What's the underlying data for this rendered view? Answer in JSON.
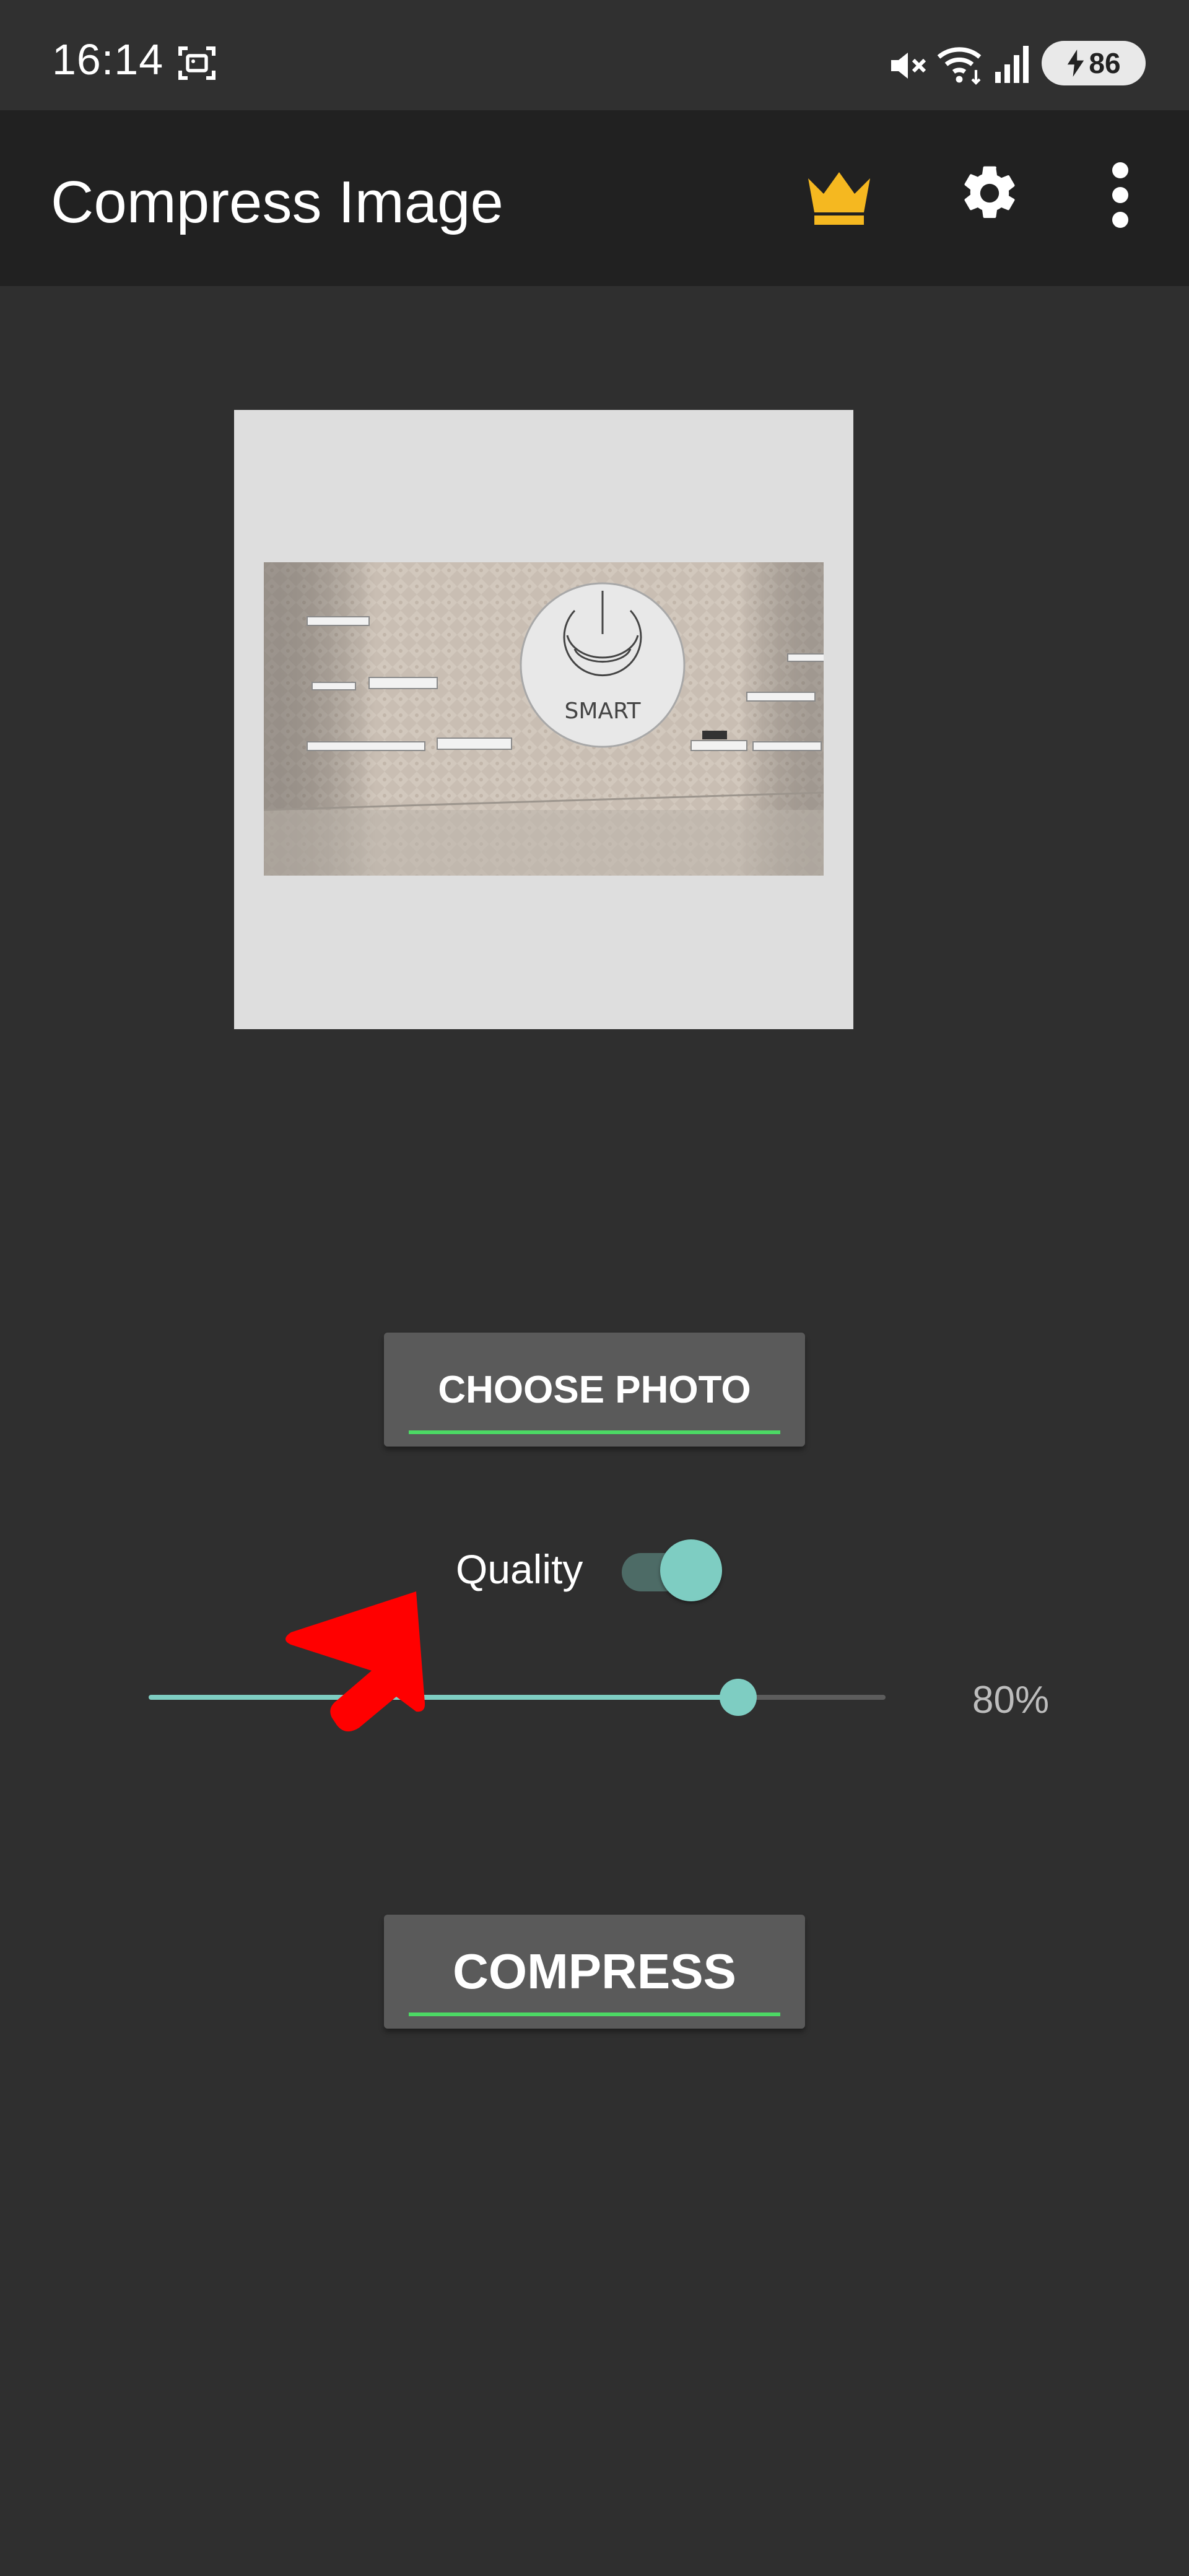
{
  "status_bar": {
    "time": "16:14",
    "battery_level": "86",
    "icons": [
      "screenshot-icon",
      "mute-icon",
      "wifi-icon",
      "signal-icon",
      "battery-icon"
    ]
  },
  "app_bar": {
    "title": "Compress Image",
    "actions": [
      "crown-icon",
      "gear-icon",
      "more-vert-icon"
    ],
    "crown_color": "#f5b820"
  },
  "preview": {
    "sign_text": "SMART"
  },
  "buttons": {
    "choose_photo": "CHOOSE PHOTO",
    "compress": "COMPRESS",
    "underline_color": "#4cd964"
  },
  "quality": {
    "label": "Quality",
    "enabled": true,
    "value_percent": 80,
    "value_label": "80%",
    "accent_color": "#7ecdc2"
  },
  "annotation": {
    "arrow_color": "#ff0000"
  }
}
